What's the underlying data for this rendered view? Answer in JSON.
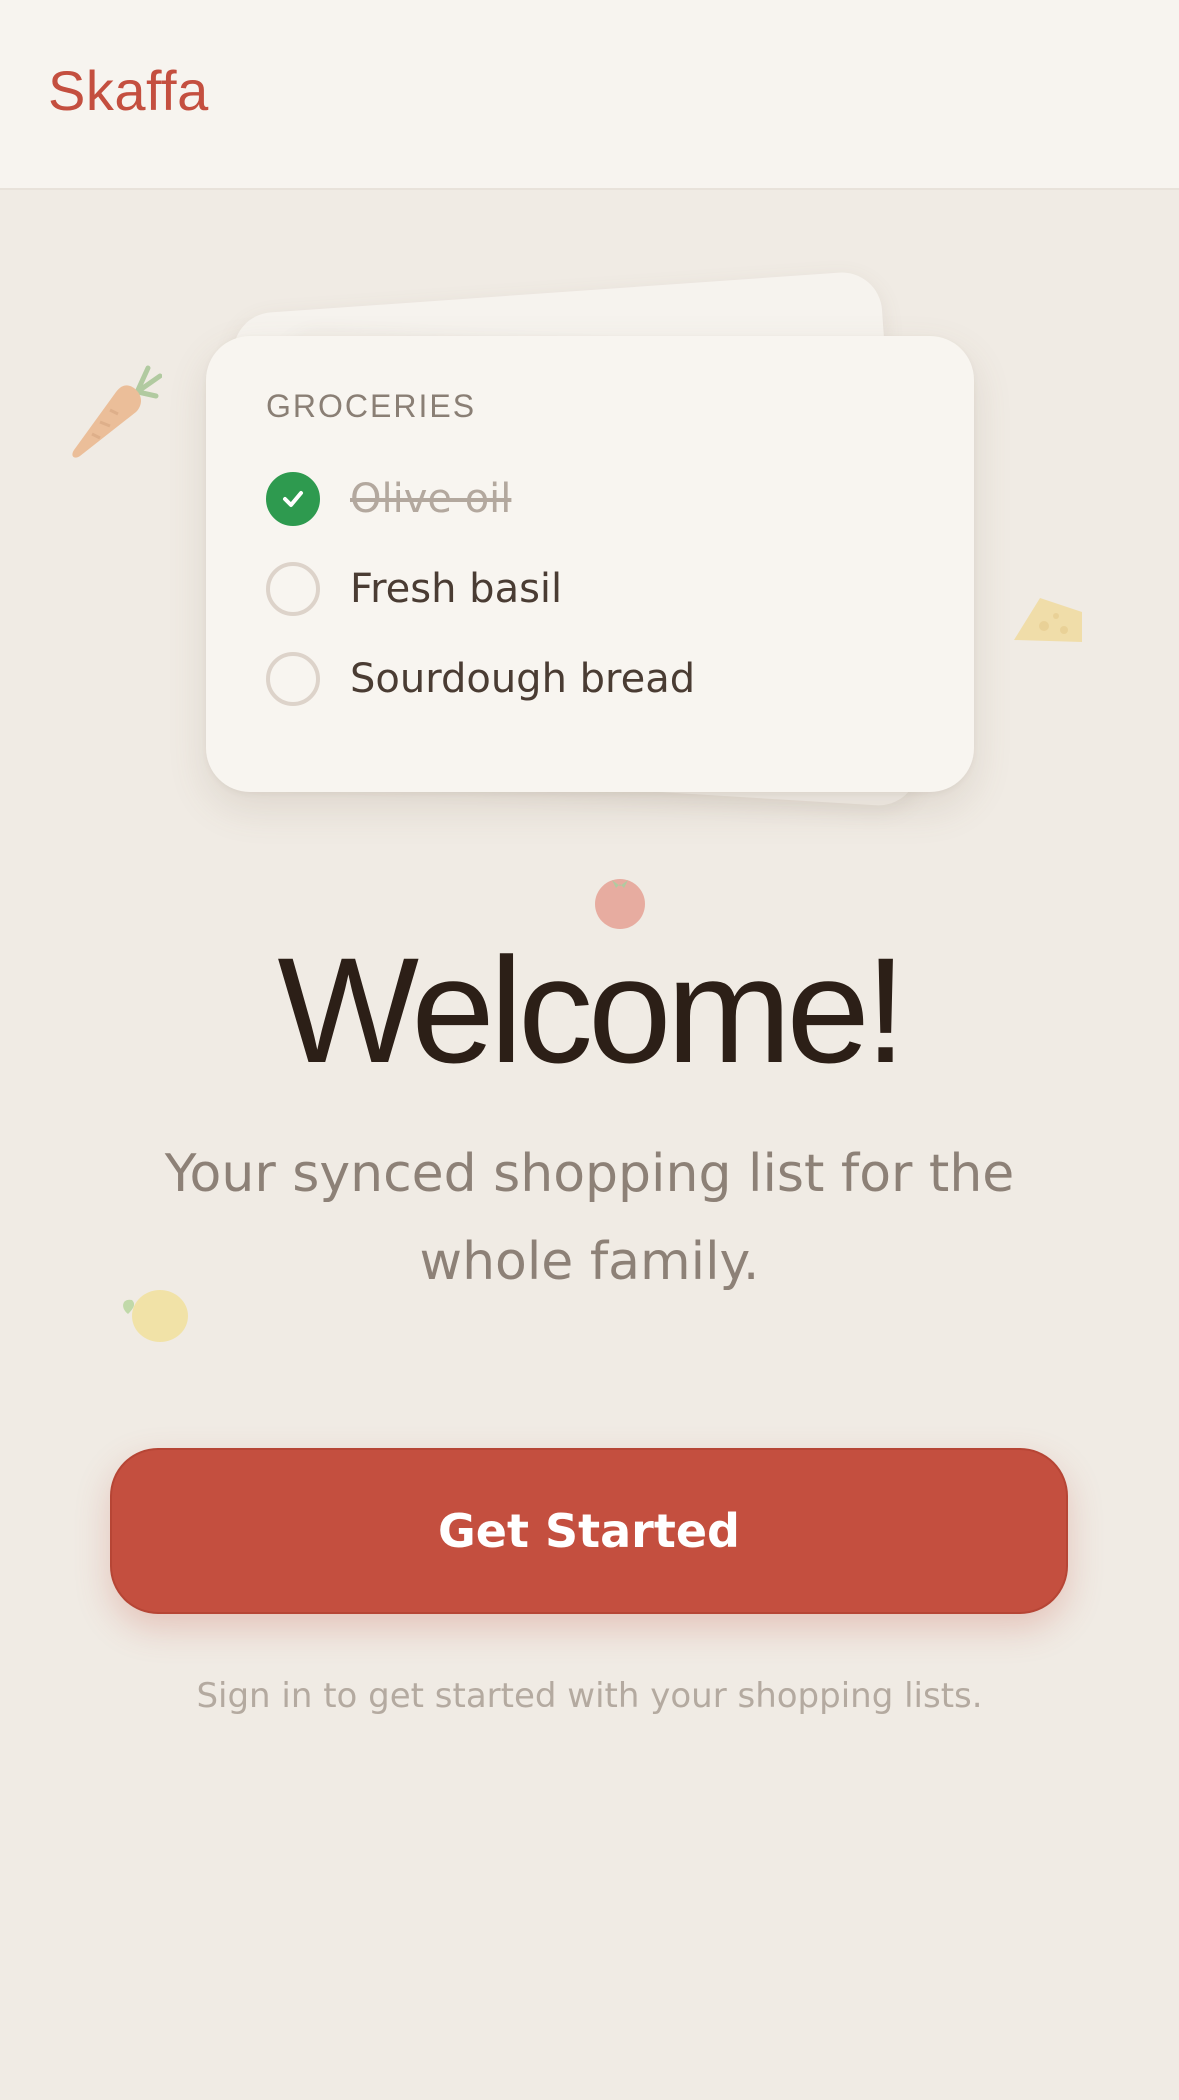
{
  "header": {
    "brand": "Skaffa"
  },
  "decorations": [
    "carrot-icon",
    "cheese-icon",
    "tomato-icon",
    "lemon-icon"
  ],
  "list_card": {
    "title": "GROCERIES",
    "items": [
      {
        "label": "Olive oil",
        "checked": true
      },
      {
        "label": "Fresh basil",
        "checked": false
      },
      {
        "label": "Sourdough bread",
        "checked": false
      }
    ]
  },
  "hero": {
    "title": "Welcome!",
    "subtitle": "Your synced shopping list for the whole family."
  },
  "cta": {
    "label": "Get Started"
  },
  "hint": "Sign in to get started with your shopping lists.",
  "colors": {
    "accent": "#c44f3f",
    "check_done": "#2e9a4f",
    "background": "#f0ebe4"
  }
}
